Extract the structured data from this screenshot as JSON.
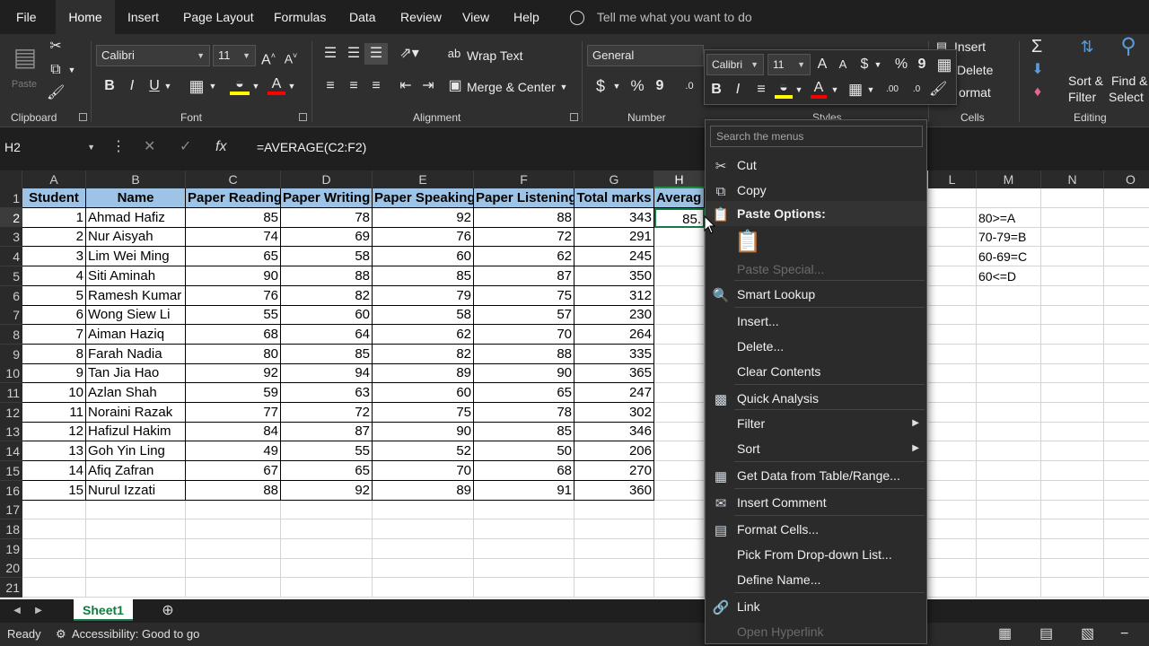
{
  "tabs": [
    "File",
    "Home",
    "Insert",
    "Page Layout",
    "Formulas",
    "Data",
    "Review",
    "View",
    "Help"
  ],
  "tell_me": "Tell me what you want to do",
  "ribbon": {
    "clipboard": {
      "label": "Clipboard",
      "paste": "Paste"
    },
    "font": {
      "label": "Font",
      "name": "Calibri",
      "size": "11"
    },
    "alignment": {
      "label": "Alignment",
      "wrap_text": "Wrap Text",
      "merge_center": "Merge & Center"
    },
    "number": {
      "label": "Number",
      "format": "General",
      "currency": "$",
      "percent": "%",
      "comma": "9"
    },
    "styles": {
      "label": "Styles"
    },
    "cells": {
      "label": "Cells",
      "insert": "Insert",
      "delete": "Delete",
      "format": "ormat"
    },
    "editing": {
      "label": "Editing",
      "sort_filter_1": "Sort &",
      "sort_filter_2": "Filter",
      "find_select_1": "Find &",
      "find_select_2": "Select"
    }
  },
  "formula_bar": {
    "name_box": "H2",
    "formula": "=AVERAGE(C2:F2)",
    "fx": "fx"
  },
  "grid": {
    "columns": [
      "A",
      "B",
      "C",
      "D",
      "E",
      "F",
      "G",
      "H",
      "L",
      "M",
      "N",
      "O"
    ],
    "headers": [
      "Student",
      "Name",
      "Paper Reading",
      "Paper Writing",
      "Paper Speaking",
      "Paper Listening",
      "Total marks",
      "Averag"
    ],
    "rows": [
      [
        "1",
        "Ahmad Hafiz",
        "85",
        "78",
        "92",
        "88",
        "343",
        "85."
      ],
      [
        "2",
        "Nur Aisyah",
        "74",
        "69",
        "76",
        "72",
        "291",
        ""
      ],
      [
        "3",
        "Lim Wei Ming",
        "65",
        "58",
        "60",
        "62",
        "245",
        ""
      ],
      [
        "4",
        "Siti Aminah",
        "90",
        "88",
        "85",
        "87",
        "350",
        ""
      ],
      [
        "5",
        "Ramesh Kumar",
        "76",
        "82",
        "79",
        "75",
        "312",
        ""
      ],
      [
        "6",
        "Wong Siew Li",
        "55",
        "60",
        "58",
        "57",
        "230",
        ""
      ],
      [
        "7",
        "Aiman Haziq",
        "68",
        "64",
        "62",
        "70",
        "264",
        ""
      ],
      [
        "8",
        "Farah Nadia",
        "80",
        "85",
        "82",
        "88",
        "335",
        ""
      ],
      [
        "9",
        "Tan Jia Hao",
        "92",
        "94",
        "89",
        "90",
        "365",
        ""
      ],
      [
        "10",
        "Azlan Shah",
        "59",
        "63",
        "60",
        "65",
        "247",
        ""
      ],
      [
        "11",
        "Noraini Razak",
        "77",
        "72",
        "75",
        "78",
        "302",
        ""
      ],
      [
        "12",
        "Hafizul Hakim",
        "84",
        "87",
        "90",
        "85",
        "346",
        ""
      ],
      [
        "13",
        "Goh Yin Ling",
        "49",
        "55",
        "52",
        "50",
        "206",
        ""
      ],
      [
        "14",
        "Afiq Zafran",
        "67",
        "65",
        "70",
        "68",
        "270",
        ""
      ],
      [
        "15",
        "Nurul Izzati",
        "88",
        "92",
        "89",
        "91",
        "360",
        ""
      ]
    ],
    "grades": [
      "80>=A",
      "70-79=B",
      "60-69=C",
      "60<=D"
    ],
    "row_numbers": [
      "1",
      "2",
      "3",
      "4",
      "5",
      "6",
      "7",
      "8",
      "9",
      "10",
      "11",
      "12",
      "13",
      "14",
      "15",
      "16",
      "17",
      "18",
      "19",
      "20",
      "21"
    ]
  },
  "sheet_tab": "Sheet1",
  "status": {
    "ready": "Ready",
    "accessibility": "Accessibility: Good to go"
  },
  "mini_toolbar": {
    "font": "Calibri",
    "size": "11"
  },
  "context_menu": {
    "search_placeholder": "Search the menus",
    "items": [
      "Cut",
      "Copy",
      "Paste Options:",
      "Paste Special...",
      "Smart Lookup",
      "Insert...",
      "Delete...",
      "Clear Contents",
      "Quick Analysis",
      "Filter",
      "Sort",
      "Get Data from Table/Range...",
      "Insert Comment",
      "Format Cells...",
      "Pick From Drop-down List...",
      "Define Name...",
      "Link",
      "Open Hyperlink"
    ]
  },
  "colors": {
    "accent": "#107c41",
    "header_fill": "#9dc3e6"
  }
}
